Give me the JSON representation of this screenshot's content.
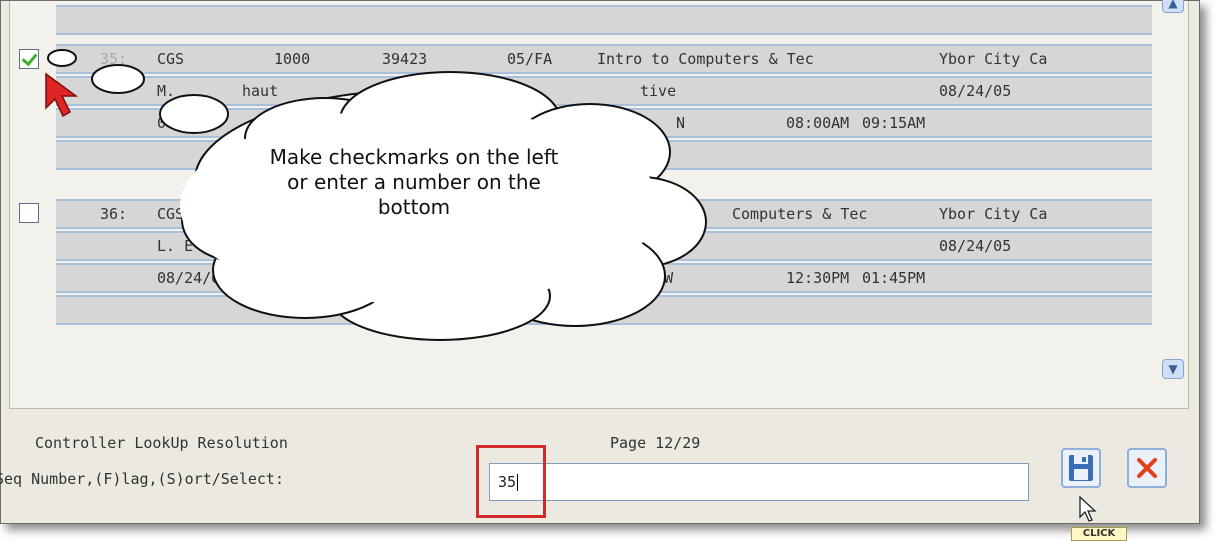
{
  "records": [
    {
      "seq": "35:",
      "prefix": "CGS",
      "number": "1000",
      "ref": "39423",
      "term": "05/FA",
      "title": "Intro to Computers & Tec",
      "campus": "Ybor City Ca",
      "checked": true
    },
    {
      "seq": "36:",
      "prefix": "CGS",
      "number": "",
      "ref": "",
      "term": "",
      "title": "Computers & Tec",
      "campus": "Ybor City Ca",
      "checked": false
    }
  ],
  "record_35_lines": {
    "instructor": "M.",
    "instructor_tail": "haut",
    "status": "tive",
    "status_date": "08/24/05",
    "start_date": "08/24/0",
    "session_tail": "N",
    "time_start": "08:00AM",
    "time_end": "09:15AM"
  },
  "record_36_lines": {
    "instructor": "L. E",
    "status_date": "08/24/05",
    "start_date": "08/24/05",
    "session": "CT MW",
    "time_start": "12:30PM",
    "time_end": "01:45PM"
  },
  "footer": {
    "title": "Controller LookUp Resolution",
    "page": "Page 12/29",
    "prompt": "Seq Number,(F)lag,(S)ort/Select:",
    "input_value": "35"
  },
  "callout": {
    "text": "Make checkmarks on the left or enter a number on the bottom"
  },
  "tooltip": {
    "text": "CLICK"
  },
  "colors": {
    "row_background": "#d6d6d6",
    "row_border": "#a9c0dc",
    "highlight": "#d32a2a",
    "check_green": "#3fae2a",
    "save_icon": "#3a6db5",
    "close_icon": "#e0401a"
  },
  "icons": {
    "save": "floppy-disk-icon",
    "close": "close-x-icon",
    "scroll_up": "chevron-up-icon",
    "scroll_down": "chevron-down-icon",
    "pointer": "red-arrow-cursor-icon",
    "mouse": "mouse-pointer-icon"
  }
}
